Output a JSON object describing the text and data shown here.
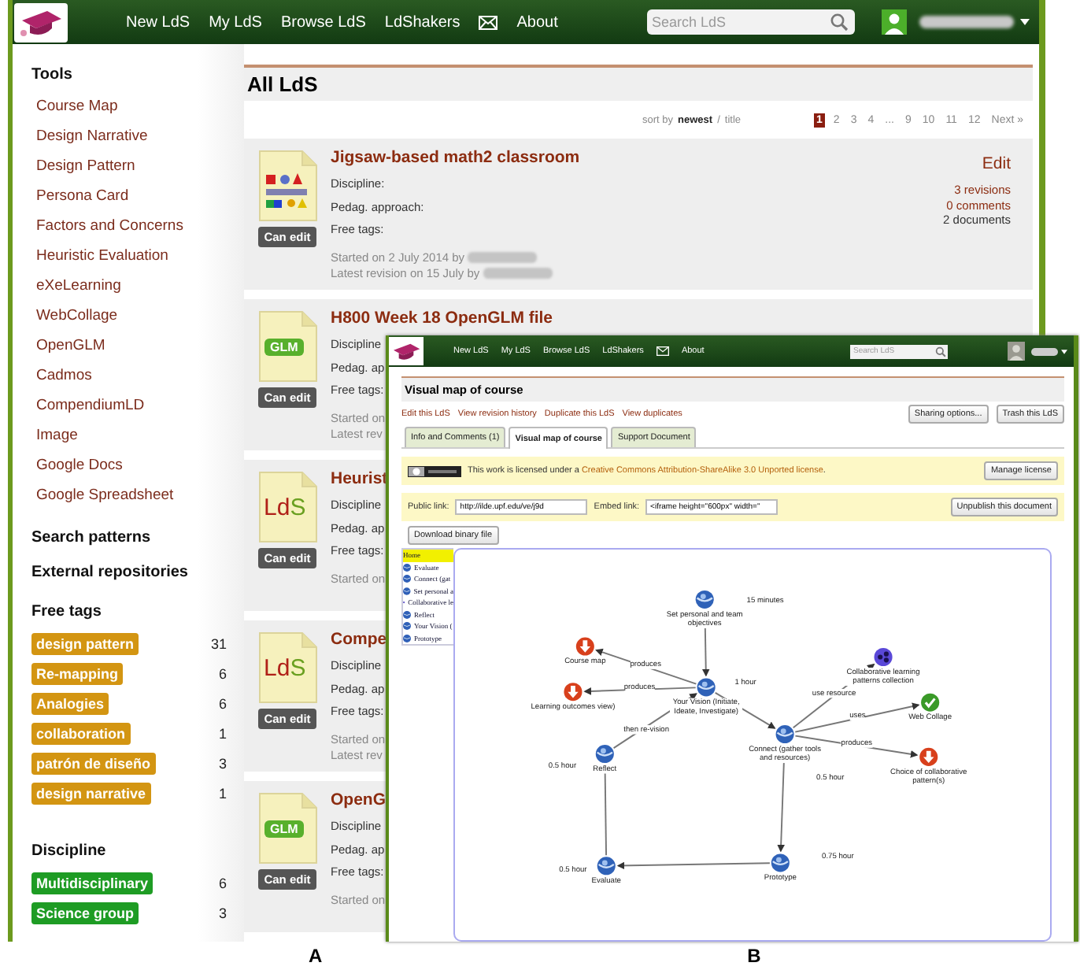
{
  "a": {
    "nav": [
      {
        "kind": "link",
        "label": "New LdS"
      },
      {
        "kind": "link",
        "label": "My LdS"
      },
      {
        "kind": "link",
        "label": "Browse LdS"
      },
      {
        "kind": "link",
        "label": "LdShakers"
      },
      {
        "kind": "mail"
      },
      {
        "kind": "link",
        "label": "About"
      }
    ],
    "search": {
      "placeholder": "Search LdS"
    },
    "sidebar": {
      "tools_heading": "Tools",
      "tools": [
        "Course Map",
        "Design Narrative",
        "Design Pattern",
        "Persona Card",
        "Factors and Concerns",
        "Heuristic Evaluation",
        "eXeLearning",
        "WebCollage",
        "OpenGLM",
        "Cadmos",
        "CompendiumLD",
        "Image",
        "Google Docs",
        "Google Spreadsheet"
      ],
      "links": [
        "Search patterns",
        "External repositories"
      ],
      "free_tags_heading": "Free tags",
      "free_tags": [
        {
          "label": "design pattern",
          "count": "31"
        },
        {
          "label": "Re-mapping",
          "count": "6"
        },
        {
          "label": "Analogies",
          "count": "6"
        },
        {
          "label": "collaboration",
          "count": "1"
        },
        {
          "label": "patrón de diseño",
          "count": "3"
        },
        {
          "label": "design narrative",
          "count": "1"
        }
      ],
      "discipline_heading": "Discipline",
      "disciplines": [
        {
          "label": "Multidisciplinary",
          "count": "6"
        },
        {
          "label": "Science group",
          "count": "3"
        }
      ]
    },
    "title": "All LdS",
    "sort": {
      "prefix": "sort by",
      "separator": "/",
      "options": [
        {
          "label": "newest",
          "selected": true
        },
        {
          "label": "title",
          "selected": false
        }
      ]
    },
    "pages": [
      {
        "label": "1",
        "selected": true
      },
      {
        "label": "2",
        "selected": false
      },
      {
        "label": "3",
        "selected": false
      },
      {
        "label": "4",
        "selected": false
      },
      {
        "label": "...",
        "selected": false
      },
      {
        "label": "9",
        "selected": false
      },
      {
        "label": "10",
        "selected": false
      },
      {
        "label": "11",
        "selected": false
      },
      {
        "label": "12",
        "selected": false
      },
      {
        "label": "Next »",
        "selected": false
      }
    ],
    "cards": [
      {
        "kind": "collage",
        "badge": "Can edit",
        "title": "Jigsaw-based math2 classroom",
        "fields": [
          "Discipline:",
          "Pedag. approach:",
          "Free tags:"
        ],
        "started": "Started on 2 July 2014 by",
        "latest": "Latest revision on 15 July by",
        "author_blurred": true,
        "edit": "Edit",
        "stats": [
          "3 revisions",
          "0 comments",
          "2 documents"
        ]
      },
      {
        "kind": "glm",
        "thumb_text": "GLM",
        "badge": "Can edit",
        "title": "H800 Week 18 OpenGLM file",
        "fields": [
          "Discipline",
          "Pedag. ap",
          "Free tags:"
        ],
        "started": "Started on",
        "latest": "Latest rev"
      },
      {
        "kind": "lds",
        "thumb_text": [
          "Ld",
          "S"
        ],
        "badge": "Can edit",
        "title": "Heurist",
        "fields": [
          "Discipline",
          "Pedag. ap",
          "Free tags:"
        ],
        "started": "Started on"
      },
      {
        "kind": "lds",
        "thumb_text": [
          "Ld",
          "S"
        ],
        "badge": "Can edit",
        "title": "Compe",
        "fields": [
          "Discipline",
          "Pedag. ap",
          "Free tags:"
        ],
        "started": "Started on",
        "latest": "Latest rev"
      },
      {
        "kind": "glm",
        "thumb_text": "GLM",
        "badge": "Can edit",
        "title": "OpenG",
        "fields": [
          "Discipline",
          "Pedag. ap",
          "Free tags:"
        ],
        "started": "Started on"
      }
    ]
  },
  "b": {
    "nav": [
      {
        "kind": "link",
        "label": "New LdS"
      },
      {
        "kind": "link",
        "label": "My LdS"
      },
      {
        "kind": "link",
        "label": "Browse LdS"
      },
      {
        "kind": "link",
        "label": "LdShakers"
      },
      {
        "kind": "mail"
      },
      {
        "kind": "link",
        "label": "About"
      }
    ],
    "search": {
      "placeholder": "Search LdS"
    },
    "title": "Visual map of course",
    "actions": [
      "Edit this LdS",
      "View revision history",
      "Duplicate this LdS",
      "View duplicates"
    ],
    "buttons": [
      "Sharing options...",
      "Trash this LdS"
    ],
    "tabs": [
      {
        "label": "Info and Comments (1)",
        "selected": false
      },
      {
        "label": "Visual map of course",
        "selected": true
      },
      {
        "label": "Support Document",
        "selected": false
      }
    ],
    "license": {
      "prefix": "This work is licensed under a",
      "link": "Creative Commons Attribution-ShareAlike 3.0 Unported license",
      "suffix": ".",
      "button": "Manage license"
    },
    "links": {
      "public_label": "Public link:",
      "public_value": "http://ilde.upf.edu/ve/j9d",
      "embed_label": "Embed link:",
      "embed_value": "<iframe height=\"600px\" width=\"",
      "button": "Unpublish this document"
    },
    "download": "Download binary file",
    "tree": [
      {
        "label": "Home",
        "kind": "none",
        "selected": true
      },
      {
        "label": "Evaluate",
        "kind": "activity",
        "selected": false
      },
      {
        "label": "Connect (gat",
        "kind": "activity",
        "selected": false
      },
      {
        "label": "Set personal a",
        "kind": "activity",
        "selected": false
      },
      {
        "label": "Collaborative le",
        "kind": "resource",
        "selected": false
      },
      {
        "label": "Reflect",
        "kind": "activity",
        "selected": false
      },
      {
        "label": "Your Vision (",
        "kind": "activity",
        "selected": false
      },
      {
        "label": "Prototype",
        "kind": "activity",
        "selected": false
      }
    ],
    "map": {
      "nodes": [
        {
          "label": "Set personal and team objectives",
          "time": "15 minutes",
          "kind": "activity"
        },
        {
          "label": "Course map",
          "kind": "output"
        },
        {
          "label": "Learning outcomes view)",
          "kind": "output"
        },
        {
          "label": "Your Vision (Initiate, Ideate, Investigate)",
          "time": "1 hour",
          "kind": "activity"
        },
        {
          "label": "Connect (gather tools and resources)",
          "time": "0.5 hour",
          "kind": "activity"
        },
        {
          "label": "Collaborative learning patterns collection",
          "kind": "resource"
        },
        {
          "label": "Web Collage",
          "kind": "tool"
        },
        {
          "label": "Choice of collaborative pattern(s)",
          "kind": "output"
        },
        {
          "label": "Reflect",
          "time": "0.5 hour",
          "kind": "activity"
        },
        {
          "label": "Evaluate",
          "time": "0.5 hour",
          "kind": "activity"
        },
        {
          "label": "Prototype",
          "time": "0.75 hour",
          "kind": "activity"
        }
      ],
      "edges": [
        {
          "kind": "plain"
        },
        {
          "kind": "labeled",
          "label": "produces"
        },
        {
          "kind": "labeled",
          "label": "produces"
        },
        {
          "kind": "plain"
        },
        {
          "kind": "labeled",
          "label": "use resource"
        },
        {
          "kind": "labeled",
          "label": "uses"
        },
        {
          "kind": "labeled",
          "label": "produces"
        },
        {
          "kind": "plain"
        },
        {
          "kind": "plain"
        },
        {
          "kind": "plain"
        },
        {
          "kind": "labeled",
          "label": "then re-vision"
        }
      ]
    }
  },
  "panel_labels": [
    "A",
    "B"
  ]
}
